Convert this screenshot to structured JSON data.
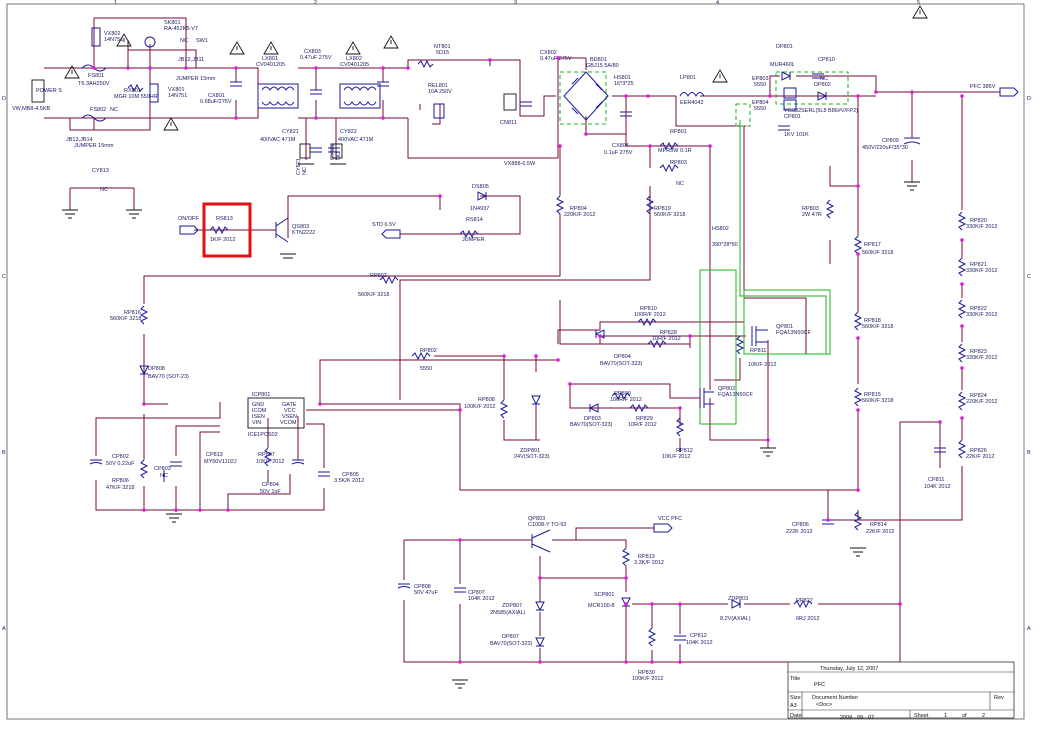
{
  "border": {
    "cols": [
      "1",
      "2",
      "3",
      "4",
      "5"
    ],
    "rows": [
      "D",
      "C",
      "B",
      "A"
    ]
  },
  "labels": {
    "vx801": [
      "VX802",
      "14N751"
    ],
    "sk801": [
      "SK801",
      "RA-452K5-V7"
    ],
    "sw1": [
      "NC",
      "SW1"
    ],
    "jb12": [
      "JB12,JB11",
      "JUMPER 15mm"
    ],
    "fs801": [
      "FS801",
      "T6.3AH250V"
    ],
    "fs802": [
      "FS802",
      "NC"
    ],
    "rx801": [
      "RX801",
      "MGR 10M 550HR"
    ],
    "vx803": [
      "VX801",
      "14N751"
    ],
    "jb13": [
      "JB13,JB14",
      "JUMPER 15mm"
    ],
    "cx801": [
      "CX801",
      "0.68uF/275V"
    ],
    "lx801": [
      "LX801",
      "CV0401205"
    ],
    "cx803": [
      "CX803",
      "0.47uF 275V"
    ],
    "lx802": [
      "LX802",
      "CV0401205"
    ],
    "cy821": [
      "CY821",
      "400VAC 471M"
    ],
    "cy822": [
      "CY822",
      "400VAC 471M"
    ],
    "cy822n": [
      "CY822",
      "NC"
    ],
    "cy821n": [
      "CY821",
      "NC"
    ],
    "nt801": [
      "NT801",
      "5D15"
    ],
    "rel801": [
      "REL801",
      "10A 250V"
    ],
    "cx802": [
      "CX802",
      "0.47uF 275V"
    ],
    "bd801": [
      "BD801",
      "GBJ15 5A/80"
    ],
    "cn811": "CN811",
    "hs801": [
      "HS801",
      "16*3*25"
    ],
    "lp801": [
      "LP801",
      "EER4042"
    ],
    "dp801": [
      "DP801",
      "MUR460L"
    ],
    "cp810": [
      "CP810",
      "NC"
    ],
    "dp802": "DP802",
    "ep803": [
      "EP803",
      "5550"
    ],
    "ep804": [
      "EP804",
      "5550"
    ],
    "ybd": "YG382SERL(5L8 B86#V/FP2)",
    "cp801": [
      "CP801",
      "1KV 101K"
    ],
    "pfc_out": "PFC 385V",
    "cp809": [
      "CP809",
      "450V/220uF/35*30"
    ],
    "power": [
      "POWER S",
      "VW,MB8-4.5KB"
    ],
    "cy813": [
      "CY813",
      "NC"
    ],
    "cx804": [
      "CX804",
      "0.1uF 275V"
    ],
    "vx888": "VX888-0.5W",
    "rp801": [
      "RP801",
      "MPR5W 0.1R"
    ],
    "rp803": [
      "RP803",
      "NC"
    ],
    "ds805": [
      "DS805",
      "1N4937"
    ],
    "onoff": "ON/OFF",
    "rs813": [
      "RS813",
      "1K/F 2012"
    ],
    "qs803": [
      "QS803",
      "KTN2222"
    ],
    "std": "STD 6.5V",
    "rs814": [
      "RS814",
      "JUMPER"
    ],
    "rp804": [
      "RP804",
      "220K/F 2012"
    ],
    "rp819": [
      "RP819",
      "560K/F 3218"
    ],
    "rp803b": [
      "RP803",
      "2W 47R"
    ],
    "hs802": [
      "HS802",
      "390*28*50"
    ],
    "rp817": [
      "RP817",
      "560K/F 3218"
    ],
    "rp820": [
      "RP820",
      "330K/F 2012"
    ],
    "rp821": [
      "RP821",
      "330K/F 2012"
    ],
    "rp822": [
      "RP822",
      "330K/F 2012"
    ],
    "rp823": [
      "RP823",
      "330K/F 2012"
    ],
    "rp824": [
      "RP824",
      "220K/F 2012"
    ],
    "rp826": [
      "RP826",
      "22K/F 2012"
    ],
    "rp802": [
      "RP802",
      "560K/F 3218"
    ],
    "rp818": [
      "RP818",
      "560K/F 3218"
    ],
    "rp816": [
      "RP816",
      "560K/F 3218"
    ],
    "dp808": [
      "DP808",
      "BAV70 (SOT-23)"
    ],
    "rp810": [
      "RP810",
      "100R/F 2012"
    ],
    "rp828": [
      "RP828",
      "10R/F 2012"
    ],
    "dp804": [
      "DP804",
      "BAV70(SOT-323)"
    ],
    "qp801": [
      "QP801",
      "FQA13N50CF"
    ],
    "rp811": [
      "RP811",
      "10K/F 2012"
    ],
    "rp802b": [
      "RP802",
      "5550"
    ],
    "rp808": [
      "RP808",
      "100K/F 2012"
    ],
    "zdp801": [
      "ZDP801",
      "24V(SOT-323)"
    ],
    "rp809": [
      "RP809",
      "100R/F 2012"
    ],
    "rp829": [
      "RP829",
      "10R/F 2012"
    ],
    "dp803": [
      "DP803",
      "BAV70(SOT-323)"
    ],
    "qp802": [
      "QP802",
      "FQA13N50CF"
    ],
    "rp812": [
      "RP812",
      "10K/F 2012"
    ],
    "icp801": [
      "ICP801",
      "ICE1PCS02"
    ],
    "ic_pins_left": [
      "GND",
      "ICOM",
      "ISEN",
      "VIN"
    ],
    "ic_pins_right": [
      "GATE",
      "VCC",
      "VSEN",
      "VCOM"
    ],
    "cp802": [
      "CP802",
      "50V 0.22uF"
    ],
    "rp806": [
      "RP806",
      "47K/F 3218"
    ],
    "cp803": [
      "CP803",
      "NC"
    ],
    "cp813": [
      "CP813",
      "MY50V1102J"
    ],
    "rp807": [
      "RP807",
      "10K/F 2012"
    ],
    "cp804": [
      "CP804",
      "50V 1uF"
    ],
    "cp805": [
      "CP805",
      "3.5K/K 2012"
    ],
    "cp811": [
      "CP811",
      "104K 2012"
    ],
    "rp815": [
      "RP815",
      "560K/F 3218"
    ],
    "cp806": [
      "CP806",
      "222K 2012"
    ],
    "rp814": [
      "RP814",
      "22K/F 2012"
    ],
    "qp803": [
      "QP803",
      "C1008-Y TO-92"
    ],
    "vcc_pfc": "VCC PFC",
    "rp813": [
      "RP813",
      "3.3K/F 2012"
    ],
    "cp808": [
      "CP808",
      "50V 47uF"
    ],
    "cp807": [
      "CP807",
      "104K 2012"
    ],
    "zdp807": [
      "ZDP807",
      "2N585(AXIAL)"
    ],
    "dp807": [
      "DP807",
      "BAV70(SOT-323)"
    ],
    "scp801": [
      "SCP801",
      "MCR100-8"
    ],
    "zdp803": [
      "ZDP803",
      "8.2V(AXIAL)"
    ],
    "rp827": [
      "RP827",
      "6RJ 2012"
    ],
    "cp812": [
      "CP812",
      "104K 2012"
    ],
    "rp830": [
      "RP830",
      "100K/F 2012"
    ]
  },
  "title_block": {
    "date_top": "Thursday, July 12, 2007",
    "title_label": "Title",
    "title": "PFC",
    "size_label": "Size",
    "size": "A3",
    "docnum_label": "Document Number",
    "docnum": "<Doc>",
    "rev_label": "Rev",
    "date_label": "Date:",
    "date": "2009 - 09 - 07",
    "sheet_label": "Sheet",
    "sheet": "1",
    "of_label": "of",
    "sheets": "2"
  },
  "colors": {
    "wire": "#7a0a3a",
    "component": "#1a1a9a",
    "heatsink": "#18b418",
    "junction": "#d61fd6",
    "highlight": "#e01010"
  }
}
